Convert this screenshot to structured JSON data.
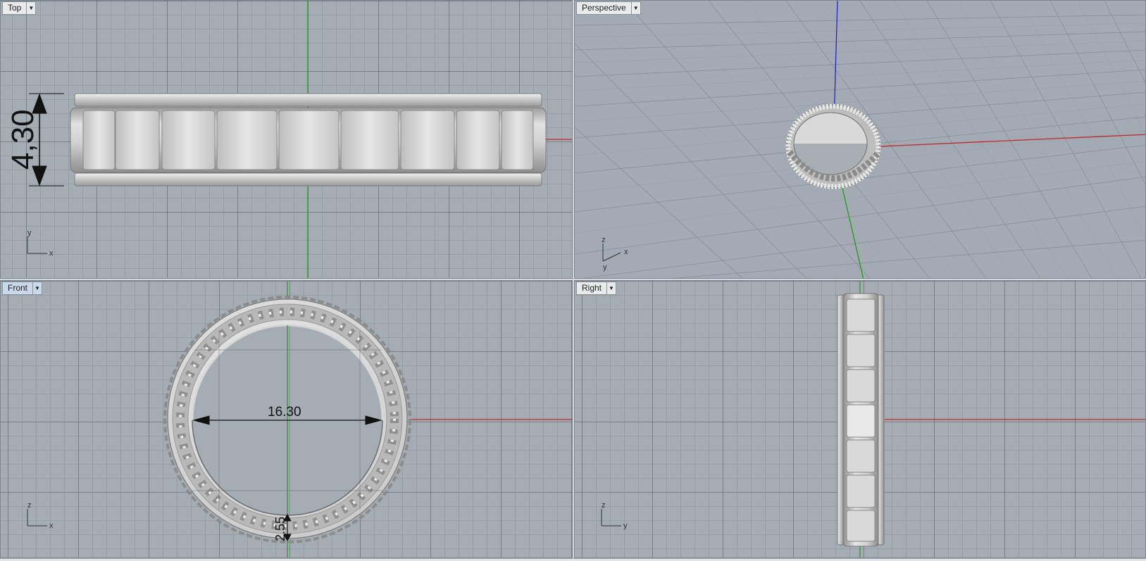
{
  "viewports": {
    "top": {
      "label": "Top",
      "dimension": "4,30",
      "axis_a": "y",
      "axis_b": "x"
    },
    "perspective": {
      "label": "Perspective",
      "axis_a": "z",
      "axis_b": "x",
      "axis_c": "y"
    },
    "front": {
      "label": "Front",
      "dimension_diameter": "16.30",
      "dimension_thickness": "2.55",
      "axis_a": "z",
      "axis_b": "x"
    },
    "right": {
      "label": "Right",
      "axis_a": "z",
      "axis_b": "y"
    }
  },
  "icons": {
    "viewport_menu": "triangle-down-icon"
  },
  "colors": {
    "x_axis": "#c0282d",
    "y_axis": "#1f9b1f",
    "z_axis": "#2424c8",
    "grid_background": "#a5acb4",
    "active_tab": "#c9d8ea"
  }
}
